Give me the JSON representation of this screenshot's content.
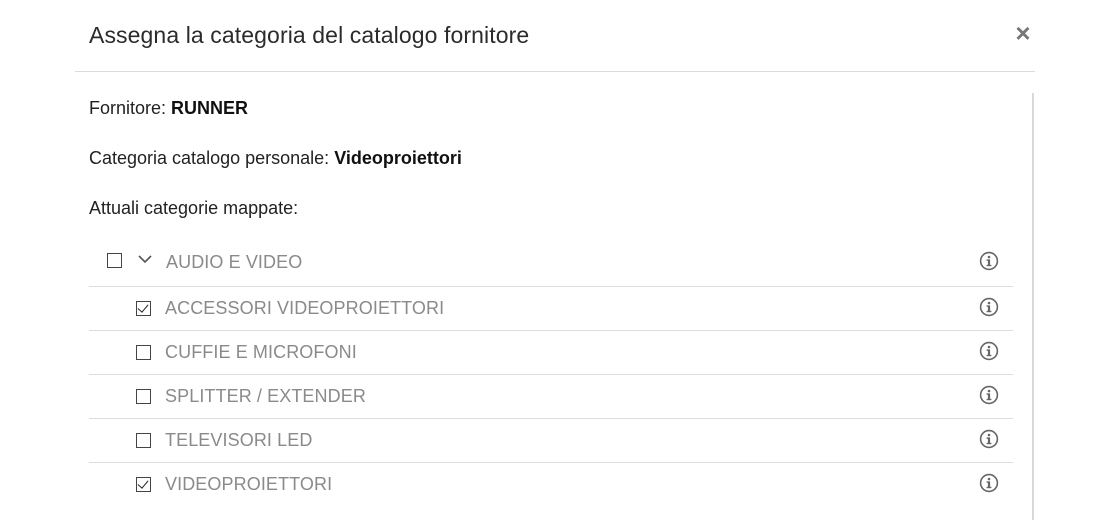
{
  "dialog": {
    "title": "Assegna la categoria del catalogo fornitore",
    "close_symbol": "×"
  },
  "info": {
    "supplier_label": "Fornitore:",
    "supplier_value": "RUNNER",
    "personal_category_label": "Categoria catalogo personale:",
    "personal_category_value": "Videoproiettori",
    "mapped_label": "Attuali categorie mappate:"
  },
  "tree": {
    "parent": {
      "label": "AUDIO E VIDEO",
      "checked": false,
      "expanded": true
    },
    "children": [
      {
        "label": "ACCESSORI VIDEOPROIETTORI",
        "checked": true
      },
      {
        "label": "CUFFIE E MICROFONI",
        "checked": false
      },
      {
        "label": "SPLITTER / EXTENDER",
        "checked": false
      },
      {
        "label": "TELEVISORI LED",
        "checked": false
      },
      {
        "label": "VIDEOPROIETTORI",
        "checked": true
      }
    ]
  },
  "icons": {
    "close": "close-icon",
    "chevron": "chevron-down-icon",
    "info": "info-circle-icon"
  },
  "colors": {
    "label_gray": "#8a8a8a",
    "divider": "#dedede",
    "icon_gray": "#666666"
  }
}
